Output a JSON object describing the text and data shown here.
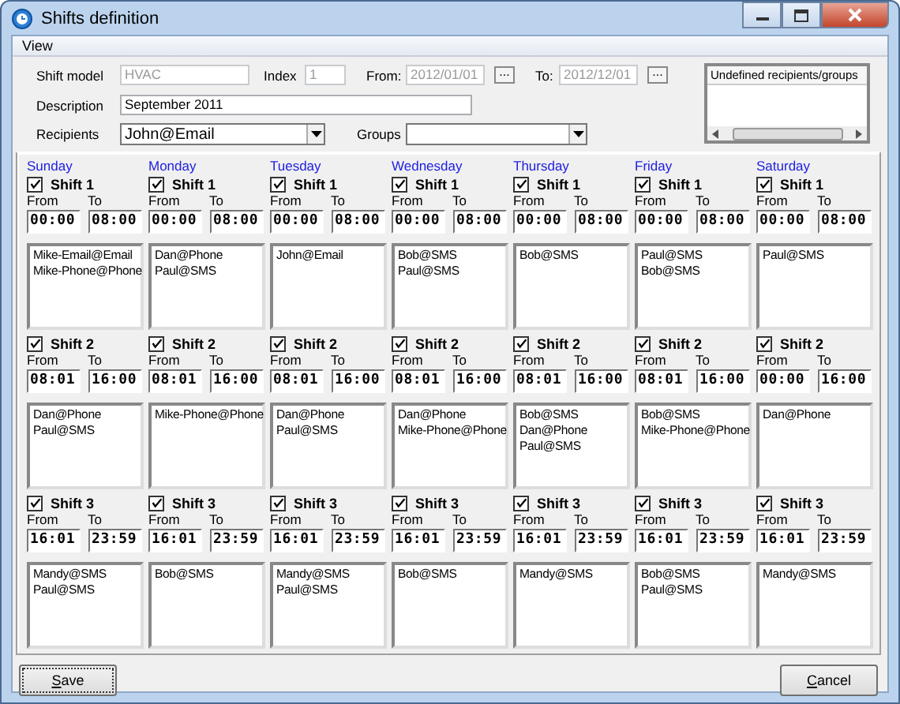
{
  "window": {
    "title": "Shifts definition"
  },
  "menu": [
    {
      "label": "View"
    }
  ],
  "form": {
    "shift_model_label": "Shift model",
    "shift_model": "HVAC",
    "index_label": "Index",
    "index": "1",
    "from_label": "From:",
    "from": "2012/01/01",
    "from_button": "...",
    "to_label": "To:",
    "to": "2012/12/01",
    "to_button": "...",
    "description_label": "Description",
    "description": "September 2011",
    "recipients_label": "Recipients",
    "recipients": "John@Email",
    "groups_label": "Groups"
  },
  "undefined_panel": {
    "title": "Undefined recipients/groups"
  },
  "days": [
    {
      "name": "Sunday",
      "shifts": [
        {
          "label": "Shift 1",
          "checked": true,
          "from_label": "From",
          "to_label": "To",
          "from": "00:00",
          "to": "08:00",
          "recipients": [
            "Mike-Email@Email",
            "Mike-Phone@Phone"
          ]
        },
        {
          "label": "Shift 2",
          "checked": true,
          "from_label": "From",
          "to_label": "To",
          "from": "08:01",
          "to": "16:00",
          "recipients": [
            "Dan@Phone",
            "Paul@SMS"
          ]
        },
        {
          "label": "Shift 3",
          "checked": true,
          "from_label": "From",
          "to_label": "To",
          "from": "16:01",
          "to": "23:59",
          "recipients": [
            "Mandy@SMS",
            "Paul@SMS"
          ]
        }
      ]
    },
    {
      "name": "Monday",
      "shifts": [
        {
          "label": "Shift 1",
          "checked": true,
          "from_label": "From",
          "to_label": "To",
          "from": "00:00",
          "to": "08:00",
          "recipients": [
            "Dan@Phone",
            "Paul@SMS"
          ]
        },
        {
          "label": "Shift 2",
          "checked": true,
          "from_label": "From",
          "to_label": "To",
          "from": "08:01",
          "to": "16:00",
          "recipients": [
            "Mike-Phone@Phone"
          ]
        },
        {
          "label": "Shift 3",
          "checked": true,
          "from_label": "From",
          "to_label": "To",
          "from": "16:01",
          "to": "23:59",
          "recipients": [
            "Bob@SMS"
          ]
        }
      ]
    },
    {
      "name": "Tuesday",
      "shifts": [
        {
          "label": "Shift 1",
          "checked": true,
          "from_label": "From",
          "to_label": "To",
          "from": "00:00",
          "to": "08:00",
          "recipients": [
            "John@Email"
          ]
        },
        {
          "label": "Shift 2",
          "checked": true,
          "from_label": "From",
          "to_label": "To",
          "from": "08:01",
          "to": "16:00",
          "recipients": [
            "Dan@Phone",
            "Paul@SMS"
          ]
        },
        {
          "label": "Shift 3",
          "checked": true,
          "from_label": "From",
          "to_label": "To",
          "from": "16:01",
          "to": "23:59",
          "recipients": [
            "Mandy@SMS",
            "Paul@SMS"
          ]
        }
      ]
    },
    {
      "name": "Wednesday",
      "shifts": [
        {
          "label": "Shift 1",
          "checked": true,
          "from_label": "From",
          "to_label": "To",
          "from": "00:00",
          "to": "08:00",
          "recipients": [
            "Bob@SMS",
            "Paul@SMS"
          ]
        },
        {
          "label": "Shift 2",
          "checked": true,
          "from_label": "From",
          "to_label": "To",
          "from": "08:01",
          "to": "16:00",
          "recipients": [
            "Dan@Phone",
            "Mike-Phone@Phone"
          ]
        },
        {
          "label": "Shift 3",
          "checked": true,
          "from_label": "From",
          "to_label": "To",
          "from": "16:01",
          "to": "23:59",
          "recipients": [
            "Bob@SMS"
          ]
        }
      ]
    },
    {
      "name": "Thursday",
      "shifts": [
        {
          "label": "Shift 1",
          "checked": true,
          "from_label": "From",
          "to_label": "To",
          "from": "00:00",
          "to": "08:00",
          "recipients": [
            "Bob@SMS"
          ]
        },
        {
          "label": "Shift 2",
          "checked": true,
          "from_label": "From",
          "to_label": "To",
          "from": "08:01",
          "to": "16:00",
          "recipients": [
            "Bob@SMS",
            "Dan@Phone",
            "Paul@SMS"
          ]
        },
        {
          "label": "Shift 3",
          "checked": true,
          "from_label": "From",
          "to_label": "To",
          "from": "16:01",
          "to": "23:59",
          "recipients": [
            "Mandy@SMS"
          ]
        }
      ]
    },
    {
      "name": "Friday",
      "shifts": [
        {
          "label": "Shift 1",
          "checked": true,
          "from_label": "From",
          "to_label": "To",
          "from": "00:00",
          "to": "08:00",
          "recipients": [
            "Paul@SMS",
            "Bob@SMS"
          ]
        },
        {
          "label": "Shift 2",
          "checked": true,
          "from_label": "From",
          "to_label": "To",
          "from": "08:01",
          "to": "16:00",
          "recipients": [
            "Bob@SMS",
            "Mike-Phone@Phone"
          ]
        },
        {
          "label": "Shift 3",
          "checked": true,
          "from_label": "From",
          "to_label": "To",
          "from": "16:01",
          "to": "23:59",
          "recipients": [
            "Bob@SMS",
            "Paul@SMS"
          ]
        }
      ]
    },
    {
      "name": "Saturday",
      "shifts": [
        {
          "label": "Shift 1",
          "checked": true,
          "from_label": "From",
          "to_label": "To",
          "from": "00:00",
          "to": "08:00",
          "recipients": [
            "Paul@SMS"
          ]
        },
        {
          "label": "Shift 2",
          "checked": true,
          "from_label": "From",
          "to_label": "To",
          "from": "00:00",
          "to": "16:00",
          "recipients": [
            "Dan@Phone"
          ]
        },
        {
          "label": "Shift 3",
          "checked": true,
          "from_label": "From",
          "to_label": "To",
          "from": "16:01",
          "to": "23:59",
          "recipients": [
            "Mandy@SMS"
          ]
        }
      ]
    }
  ],
  "buttons": {
    "save": "Save",
    "cancel": "Cancel"
  }
}
